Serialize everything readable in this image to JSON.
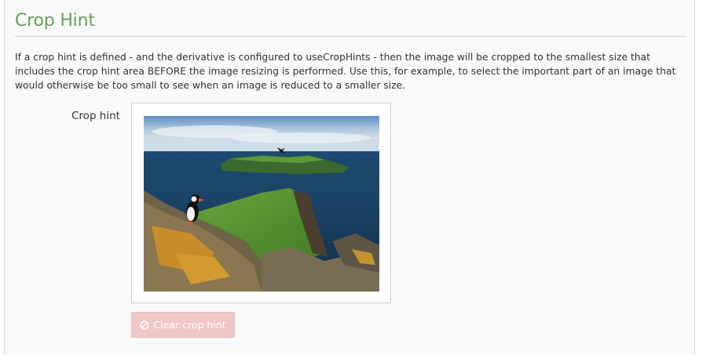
{
  "section": {
    "title": "Crop Hint",
    "description": "If a crop hint is defined - and the derivative is configured to useCropHints - then the image will be cropped to the smallest size that includes the crop hint area BEFORE the image resizing is performed. Use this, for example, to select the important part of an image that would otherwise be too small to see when an image is reduced to a smaller size."
  },
  "crop_hint": {
    "label": "Crop hint",
    "clear_button_label": "Clear crop hint",
    "clear_button_icon": "ban-icon"
  },
  "colors": {
    "title_green": "#6a9d5a",
    "button_disabled_red": "#efc7c7"
  }
}
